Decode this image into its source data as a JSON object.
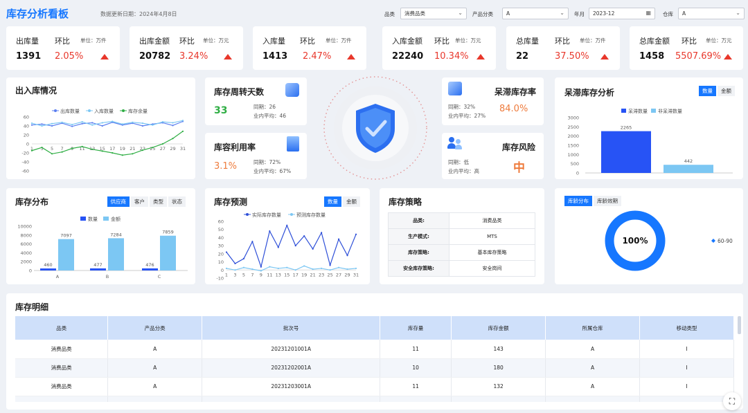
{
  "header": {
    "title": "库存分析看板",
    "update_date": "数据更新日期：2024年4月8日"
  },
  "filters": [
    {
      "label": "品类",
      "value": "消费品类"
    },
    {
      "label": "产品分类",
      "value": "A"
    },
    {
      "label": "年月",
      "value": "2023-12"
    },
    {
      "label": "仓库",
      "value": "A"
    }
  ],
  "kpis": [
    {
      "name": "出库量",
      "hb": "环比",
      "unit": "单位：万件",
      "value": "1391",
      "pct": "2.05%"
    },
    {
      "name": "出库金额",
      "hb": "环比",
      "unit": "单位：万元",
      "value": "20782",
      "pct": "3.24%"
    },
    {
      "name": "入库量",
      "hb": "环比",
      "unit": "单位：万件",
      "value": "1413",
      "pct": "2.47%"
    },
    {
      "name": "入库金额",
      "hb": "环比",
      "unit": "单位：万元",
      "value": "22240",
      "pct": "10.34%"
    },
    {
      "name": "总库量",
      "hb": "环比",
      "unit": "单位：万件",
      "value": "22",
      "pct": "37.50%"
    },
    {
      "name": "总库金额",
      "hb": "环比",
      "unit": "单位：万元",
      "value": "1458",
      "pct": "5507.69%"
    }
  ],
  "inout": {
    "title": "出入库情况",
    "legend": [
      "出库数量",
      "入库数量",
      "库存余量"
    ]
  },
  "turnover": {
    "title": "库存周转天数",
    "value": "33",
    "yoy": "同期：26",
    "avg": "业内平均：46"
  },
  "capacity": {
    "title": "库容利用率",
    "value": "3.1%",
    "yoy": "同期：72%",
    "avg": "业内平均：67%"
  },
  "stagnant_rate": {
    "title": "呆滞库存率",
    "value": "84.0%",
    "yoy": "同期：32%",
    "avg": "业内平均：27%"
  },
  "risk": {
    "title": "库存风险",
    "value": "中",
    "yoy": "同期：低",
    "avg": "业内平均：高"
  },
  "stagnant_analysis": {
    "title": "呆滞库存分析",
    "tabs": [
      "数量",
      "金额"
    ],
    "legend": [
      "呆滞数量",
      "非呆滞数量"
    ],
    "yticks": [
      "3000",
      "2500",
      "2000",
      "1500",
      "1000",
      "500",
      "0"
    ]
  },
  "distribution": {
    "title": "库存分布",
    "tabs": [
      "供应商",
      "客户",
      "类型",
      "状态"
    ],
    "legend": [
      "数量",
      "金额"
    ],
    "yticks": [
      "10000",
      "8000",
      "6000",
      "4000",
      "2000",
      "0"
    ]
  },
  "forecast": {
    "title": "库存预测",
    "tabs": [
      "数量",
      "金额"
    ],
    "legend": [
      "实际库存数量",
      "预测库存数量"
    ]
  },
  "strategy": {
    "title": "库存策略",
    "rows": [
      {
        "k": "品类:",
        "v": "消费品类"
      },
      {
        "k": "生产模式:",
        "v": "MTS"
      },
      {
        "k": "库存策略:",
        "v": "基本库存策略"
      },
      {
        "k": "安全库存策略:",
        "v": "安全岗间"
      }
    ]
  },
  "age": {
    "tabs": [
      "库龄分布",
      "库龄效期"
    ],
    "value": "100%",
    "legend": "60-90"
  },
  "detail": {
    "title": "库存明细",
    "columns": [
      "品类",
      "产品分类",
      "批次号",
      "库存量",
      "库存金额",
      "所属仓库",
      "移动类型"
    ],
    "rows": [
      [
        "消费品类",
        "A",
        "20231201001A",
        "11",
        "143",
        "A",
        "I"
      ],
      [
        "消费品类",
        "A",
        "20231202001A",
        "10",
        "180",
        "A",
        "I"
      ],
      [
        "消费品类",
        "A",
        "20231203001A",
        "11",
        "132",
        "A",
        "I"
      ]
    ]
  },
  "colors": {
    "accent": "#1677ff",
    "up": "#e8372b",
    "green": "#2fae44",
    "orange": "#ee7b3c",
    "light": "#7cc7f3"
  },
  "chart_data": [
    {
      "type": "line",
      "title": "出入库情况",
      "x": [
        "1",
        "3",
        "5",
        "7",
        "9",
        "11",
        "13",
        "15",
        "17",
        "19",
        "21",
        "23",
        "25",
        "27",
        "29",
        "31"
      ],
      "yticks": [
        "60",
        "40",
        "20",
        "0",
        "-20",
        "-40",
        "-60"
      ],
      "ylim": [
        -60,
        60
      ],
      "series": [
        {
          "name": "出库数量",
          "values": [
            42,
            44,
            40,
            46,
            39,
            45,
            47,
            40,
            48,
            42,
            46,
            40,
            44,
            47,
            41,
            50
          ]
        },
        {
          "name": "入库数量",
          "values": [
            46,
            40,
            45,
            48,
            43,
            49,
            42,
            47,
            50,
            44,
            48,
            46,
            42,
            49,
            47,
            52
          ]
        },
        {
          "name": "库存余量",
          "values": [
            -15,
            -8,
            -22,
            -18,
            -10,
            -6,
            -12,
            -16,
            -20,
            -25,
            -22,
            -14,
            -8,
            0,
            12,
            28
          ]
        }
      ]
    },
    {
      "type": "bar",
      "title": "呆滞库存分析",
      "categories": [
        "呆滞数量",
        "非呆滞数量"
      ],
      "values": [
        2265,
        442
      ],
      "ylim": [
        0,
        3000
      ]
    },
    {
      "type": "bar",
      "title": "库存分布",
      "categories": [
        "A",
        "B",
        "C"
      ],
      "ylim": [
        0,
        10000
      ],
      "series": [
        {
          "name": "数量",
          "values": [
            460,
            477,
            476
          ]
        },
        {
          "name": "金额",
          "values": [
            7097,
            7284,
            7859
          ]
        }
      ]
    },
    {
      "type": "line",
      "title": "库存预测",
      "x": [
        "1",
        "3",
        "5",
        "7",
        "9",
        "11",
        "13",
        "15",
        "17",
        "19",
        "21",
        "23",
        "25",
        "27",
        "29",
        "31"
      ],
      "yticks": [
        "60",
        "50",
        "40",
        "30",
        "20",
        "10",
        "0",
        "-10"
      ],
      "ylim": [
        -10,
        60
      ],
      "series": [
        {
          "name": "实际库存数量",
          "values": [
            22,
            8,
            14,
            35,
            4,
            48,
            28,
            55,
            30,
            42,
            26,
            46,
            6,
            38,
            18,
            44
          ]
        },
        {
          "name": "预测库存数量",
          "values": [
            2,
            0,
            3,
            1,
            -1,
            4,
            2,
            3,
            0,
            5,
            1,
            2,
            0,
            3,
            1,
            2
          ]
        }
      ]
    },
    {
      "type": "pie",
      "title": "库龄分布",
      "categories": [
        "60-90"
      ],
      "values": [
        100
      ]
    }
  ]
}
